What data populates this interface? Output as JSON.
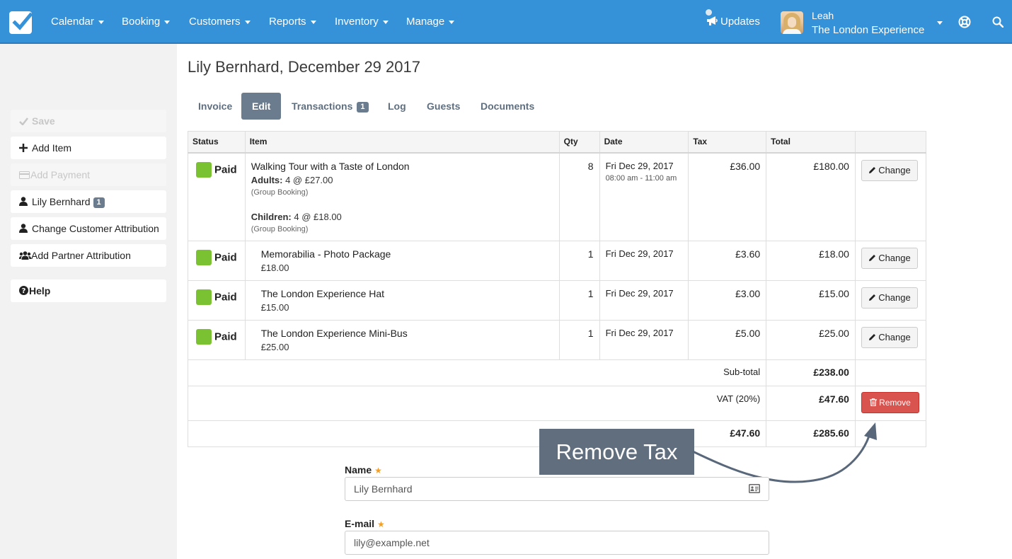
{
  "nav": {
    "items": [
      "Calendar",
      "Booking",
      "Customers",
      "Reports",
      "Inventory",
      "Manage"
    ],
    "updates": "Updates",
    "user_name": "Leah",
    "user_company": "The London Experience"
  },
  "sidebar": {
    "save": "Save",
    "add_item": "Add Item",
    "add_payment": "Add Payment",
    "customer": "Lily Bernhard",
    "customer_badge": "1",
    "change_attribution": "Change Customer Attribution",
    "add_partner": "Add Partner Attribution",
    "help": "Help"
  },
  "page": {
    "title": "Lily Bernhard, December 29 2017"
  },
  "tabs": [
    {
      "label": "Invoice",
      "active": false
    },
    {
      "label": "Edit",
      "active": true
    },
    {
      "label": "Transactions",
      "badge": "1",
      "active": false
    },
    {
      "label": "Log",
      "active": false
    },
    {
      "label": "Guests",
      "active": false
    },
    {
      "label": "Documents",
      "active": false
    }
  ],
  "table": {
    "headers": {
      "status": "Status",
      "item": "Item",
      "qty": "Qty",
      "date": "Date",
      "tax": "Tax",
      "total": "Total"
    },
    "rows": [
      {
        "status": "Paid",
        "name": "Walking Tour with a Taste of London",
        "adults_label": "Adults:",
        "adults_value": "4 @ £27.00",
        "adults_note": "(Group Booking)",
        "children_label": "Children:",
        "children_value": "4 @ £18.00",
        "children_note": "(Group Booking)",
        "qty": "8",
        "date": "Fri Dec 29, 2017",
        "time": "08:00 am - 11:00 am",
        "tax": "£36.00",
        "total": "£180.00",
        "action": "Change"
      },
      {
        "status": "Paid",
        "name": "Memorabilia - Photo Package",
        "price": "£18.00",
        "qty": "1",
        "date": "Fri Dec 29, 2017",
        "tax": "£3.60",
        "total": "£18.00",
        "action": "Change"
      },
      {
        "status": "Paid",
        "name": "The London Experience Hat",
        "price": "£15.00",
        "qty": "1",
        "date": "Fri Dec 29, 2017",
        "tax": "£3.00",
        "total": "£15.00",
        "action": "Change"
      },
      {
        "status": "Paid",
        "name": "The London Experience Mini-Bus",
        "price": "£25.00",
        "qty": "1",
        "date": "Fri Dec 29, 2017",
        "tax": "£5.00",
        "total": "£25.00",
        "action": "Change"
      }
    ],
    "subtotal_label": "Sub-total",
    "subtotal_value": "£238.00",
    "vat_label": "VAT (20%)",
    "vat_value": "£47.60",
    "remove_label": "Remove",
    "total_tax": "£47.60",
    "grand_total": "£285.60"
  },
  "annotation": {
    "text": "Remove Tax"
  },
  "form": {
    "name_label": "Name",
    "name_value": "Lily Bernhard",
    "email_label": "E-mail",
    "email_value": "lily@example.net"
  },
  "colors": {
    "nav_bg": "#3591d8",
    "paid_green": "#7ac231",
    "remove_red": "#d9534f",
    "tab_active": "#6b7c8f",
    "callout_bg": "#616e7e",
    "required_star": "#f0a02a"
  },
  "icons": {
    "logo": "checkbox-logo-icon",
    "updates": "megaphone-icon",
    "help": "lifebuoy-icon",
    "search": "search-icon",
    "change": "pencil-icon",
    "remove": "trash-icon",
    "id_card": "id-card-icon"
  }
}
